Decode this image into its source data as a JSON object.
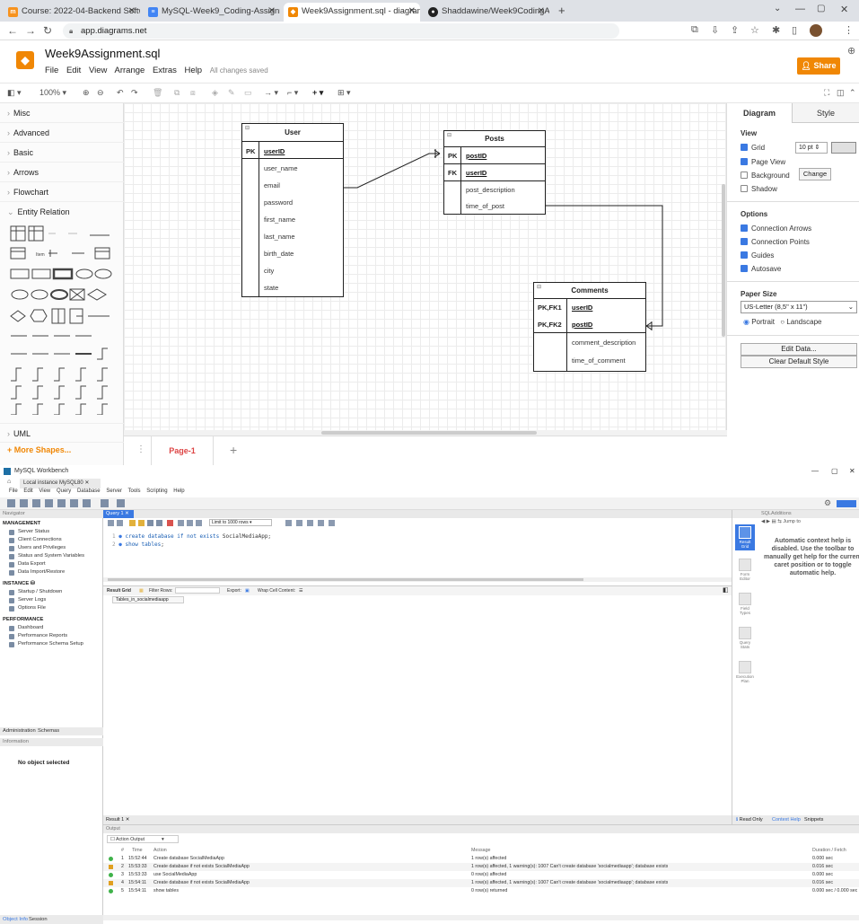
{
  "browser": {
    "tabs": [
      {
        "label": "Course: 2022-04-Backend Softw",
        "icon": "moodle-icon",
        "color": "#f7931e"
      },
      {
        "label": "MySQL-Week9_Coding-Assignm",
        "icon": "doc-icon",
        "color": "#4285f4"
      },
      {
        "label": "Week9Assignment.sql - diagram",
        "icon": "drawio-icon",
        "color": "#f08705"
      },
      {
        "label": "Shaddawine/Week9CodingAssi",
        "icon": "github-icon",
        "color": "#222222"
      }
    ],
    "new_tab": "+",
    "url": "app.diagrams.net"
  },
  "drawio": {
    "file_title": "Week9Assignment.sql",
    "menu": [
      "File",
      "Edit",
      "View",
      "Arrange",
      "Extras",
      "Help"
    ],
    "save_status": "All changes saved",
    "share_label": "Share",
    "zoom": "100%",
    "shape_categories": [
      "Misc",
      "Advanced",
      "Basic",
      "Arrows",
      "Flowchart",
      "Entity Relation"
    ],
    "item_label": "Item",
    "uml": "UML",
    "more_shapes": "+ More Shapes...",
    "page_tab": "Page-1",
    "add_page": "+",
    "entities": {
      "user": {
        "title": "User",
        "pk_label": "PK",
        "pk_field": "userID",
        "fields": [
          "user_name",
          "email",
          "password",
          "first_name",
          "last_name",
          "birth_date",
          "city",
          "state"
        ]
      },
      "posts": {
        "title": "Posts",
        "pk_label": "PK",
        "pk_field": "postID",
        "fk_label": "FK",
        "fk_field": "userID",
        "fields": [
          "post_description",
          "time_of_post"
        ]
      },
      "comments": {
        "title": "Comments",
        "k1_label": "PK,FK1",
        "k1_field": "userID",
        "k2_label": "PK,FK2",
        "k2_field": "postID",
        "fields": [
          "comment_description",
          "time_of_comment"
        ]
      }
    },
    "format": {
      "tabs": [
        "Diagram",
        "Style"
      ],
      "view_title": "View",
      "grid": "Grid",
      "grid_size": "10 pt",
      "page_view": "Page View",
      "background": "Background",
      "change": "Change",
      "shadow": "Shadow",
      "options_title": "Options",
      "options": [
        "Connection Arrows",
        "Connection Points",
        "Guides",
        "Autosave"
      ],
      "paper_title": "Paper Size",
      "paper_value": "US-Letter (8,5\" x 11\")",
      "portrait": "Portrait",
      "landscape": "Landscape",
      "edit_data": "Edit Data...",
      "clear_style": "Clear Default Style"
    }
  },
  "workbench": {
    "title": "MySQL Workbench",
    "instance_tab": "Local instance MySQL80",
    "menu": [
      "File",
      "Edit",
      "View",
      "Query",
      "Database",
      "Server",
      "Tools",
      "Scripting",
      "Help"
    ],
    "navigator_hdr": "Navigator",
    "management": "MANAGEMENT",
    "management_items": [
      "Server Status",
      "Client Connections",
      "Users and Privileges",
      "Status and System Variables",
      "Data Export",
      "Data Import/Restore"
    ],
    "instance": "INSTANCE",
    "instance_items": [
      "Startup / Shutdown",
      "Server Logs",
      "Options File"
    ],
    "performance": "PERFORMANCE",
    "performance_items": [
      "Dashboard",
      "Performance Reports",
      "Performance Schema Setup"
    ],
    "nav_tabs": [
      "Administration",
      "Schemas"
    ],
    "info_hdr": "Information",
    "no_object": "No object selected",
    "bottom_tabs": [
      "Object Info",
      "Session"
    ],
    "query_tab": "Query 1",
    "limit": "Limit to 1000 rows",
    "sql": [
      {
        "num": "1",
        "text_kw": "create database if not exists",
        "text_rest": "SocialMediaApp;"
      },
      {
        "num": "2",
        "text_kw": "show tables",
        "text_rest": ";"
      }
    ],
    "result_grid": "Result Grid",
    "filter_rows": "Filter Rows:",
    "export": "Export:",
    "wrap": "Wrap Cell Content:",
    "column_header": "Tables_in_socialmediaapp",
    "sql_additions": "SQLAdditions",
    "jump_to": "Jump to",
    "context_help": "Automatic context help is disabled. Use the toolbar to manually get help for the current caret position or to toggle automatic help.",
    "side_buttons": [
      "Result Grid",
      "Form Editor",
      "Field Types",
      "Query Stats",
      "Execution Plan"
    ],
    "result_tab": "Result 1",
    "read_only": "Read Only",
    "ctx_help_tab": "Context Help",
    "snippets_tab": "Snippets",
    "output_hdr": "Output",
    "action_output": "Action Output",
    "output_cols": {
      "num": "#",
      "time": "Time",
      "action": "Action",
      "message": "Message",
      "duration": "Duration / Fetch"
    },
    "output_rows": [
      {
        "status": "ok",
        "num": "1",
        "time": "15:52:44",
        "action": "Create database SocialMediaApp",
        "message": "1 row(s) affected",
        "duration": "0.000 sec"
      },
      {
        "status": "warn",
        "num": "2",
        "time": "15:53:33",
        "action": "Create database if not exists SocialMediaApp",
        "message": "1 row(s) affected, 1 warning(s): 1007 Can't create database 'socialmediaapp'; database exists",
        "duration": "0.016 sec"
      },
      {
        "status": "ok",
        "num": "3",
        "time": "15:53:33",
        "action": "use SocialMediaApp",
        "message": "0 row(s) affected",
        "duration": "0.000 sec"
      },
      {
        "status": "warn",
        "num": "4",
        "time": "15:54:11",
        "action": "Create database if not exists SocialMediaApp",
        "message": "1 row(s) affected, 1 warning(s): 1007 Can't create database 'socialmediaapp'; database exists",
        "duration": "0.016 sec"
      },
      {
        "status": "ok",
        "num": "5",
        "time": "15:54:11",
        "action": "show tables",
        "message": "0 row(s) returned",
        "duration": "0.000 sec / 0.000 sec"
      }
    ]
  }
}
